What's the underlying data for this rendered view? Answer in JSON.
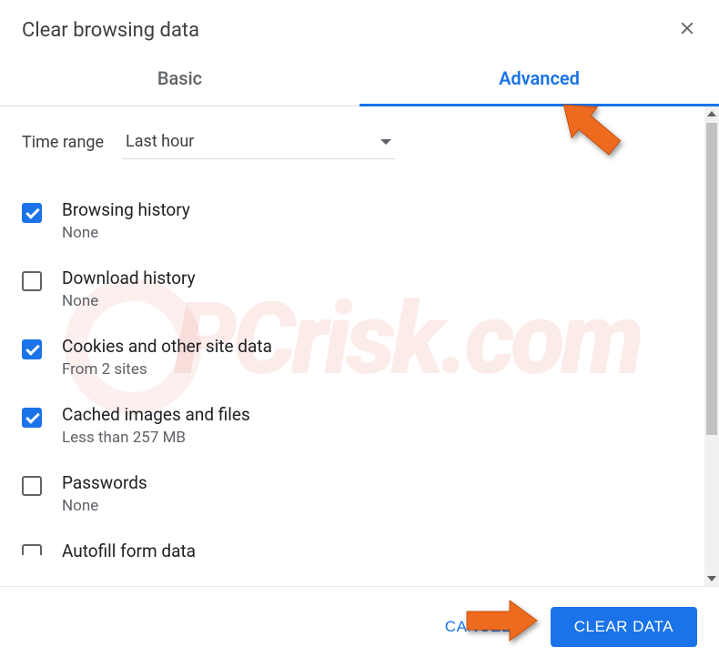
{
  "header": {
    "title": "Clear browsing data"
  },
  "tabs": {
    "basic": "Basic",
    "advanced": "Advanced"
  },
  "timeRange": {
    "label": "Time range",
    "value": "Last hour"
  },
  "items": [
    {
      "label": "Browsing history",
      "sub": "None",
      "checked": true
    },
    {
      "label": "Download history",
      "sub": "None",
      "checked": false
    },
    {
      "label": "Cookies and other site data",
      "sub": "From 2 sites",
      "checked": true
    },
    {
      "label": "Cached images and files",
      "sub": "Less than 257 MB",
      "checked": true
    },
    {
      "label": "Passwords",
      "sub": "None",
      "checked": false
    },
    {
      "label": "Autofill form data",
      "sub": "",
      "checked": false
    }
  ],
  "footer": {
    "cancel": "CANCEL",
    "clear": "CLEAR DATA"
  },
  "watermark": "PCrisk.com"
}
